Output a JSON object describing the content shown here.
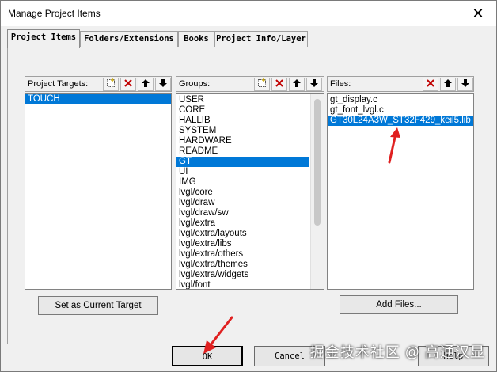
{
  "window": {
    "title": "Manage Project Items",
    "close_glyph": "✕"
  },
  "tabs": [
    {
      "label": "Project Items",
      "active": true
    },
    {
      "label": "Folders/Extensions",
      "active": false
    },
    {
      "label": "Books",
      "active": false
    },
    {
      "label": "Project Info/Layer",
      "active": false
    }
  ],
  "targets": {
    "label": "Project Targets:",
    "items": [
      "TOUCH"
    ],
    "selected": "TOUCH",
    "set_current_label": "Set as Current Target"
  },
  "groups": {
    "label": "Groups:",
    "items": [
      "USER",
      "CORE",
      "HALLIB",
      "SYSTEM",
      "HARDWARE",
      "README",
      "GT",
      "UI",
      "IMG",
      "lvgl/core",
      "lvgl/draw",
      "lvgl/draw/sw",
      "lvgl/extra",
      "lvgl/extra/layouts",
      "lvgl/extra/libs",
      "lvgl/extra/others",
      "lvgl/extra/themes",
      "lvgl/extra/widgets",
      "lvgl/font"
    ],
    "selected": "GT"
  },
  "files": {
    "label": "Files:",
    "items": [
      "gt_display.c",
      "gt_font_lvgl.c",
      "GT30L24A3W_ST32F429_keil5.lib"
    ],
    "selected": "GT30L24A3W_ST32F429_keil5.lib",
    "add_files_label": "Add Files..."
  },
  "toolbar_icons": {
    "new": "new-icon",
    "delete": "delete-icon",
    "up": "move-up-icon",
    "down": "move-down-icon"
  },
  "bottom": {
    "ok_label": "OK",
    "cancel_label": "Cancel",
    "help_label": "Help"
  },
  "watermark": "掘金技术社区 @ 高通汉显",
  "colors": {
    "selection": "#0078d7",
    "annotation_arrow": "#e02020"
  }
}
